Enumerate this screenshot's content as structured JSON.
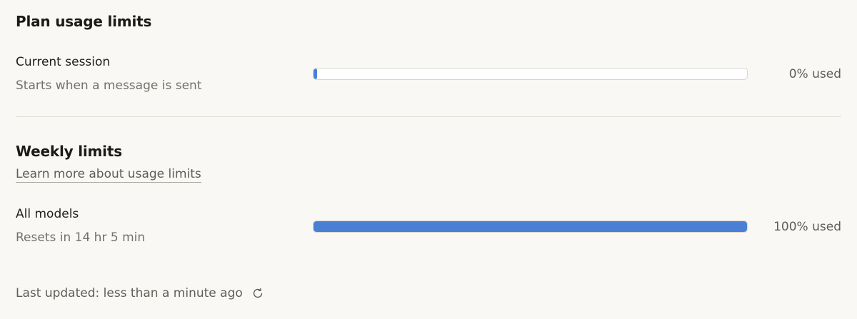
{
  "plan": {
    "title": "Plan usage limits",
    "current_session": {
      "label": "Current session",
      "sub": "Starts when a message is sent",
      "percent": 0,
      "usage_text": "0% used"
    }
  },
  "weekly": {
    "title": "Weekly limits",
    "learn_more": "Learn more about usage limits",
    "all_models": {
      "label": "All models",
      "sub": "Resets in 14 hr 5 min",
      "percent": 100,
      "usage_text": "100% used"
    }
  },
  "footer": {
    "last_updated": "Last updated: less than a minute ago",
    "refresh_icon": "refresh-icon"
  },
  "colors": {
    "bar_fill": "#4a80d4",
    "background": "#f9f8f5"
  }
}
